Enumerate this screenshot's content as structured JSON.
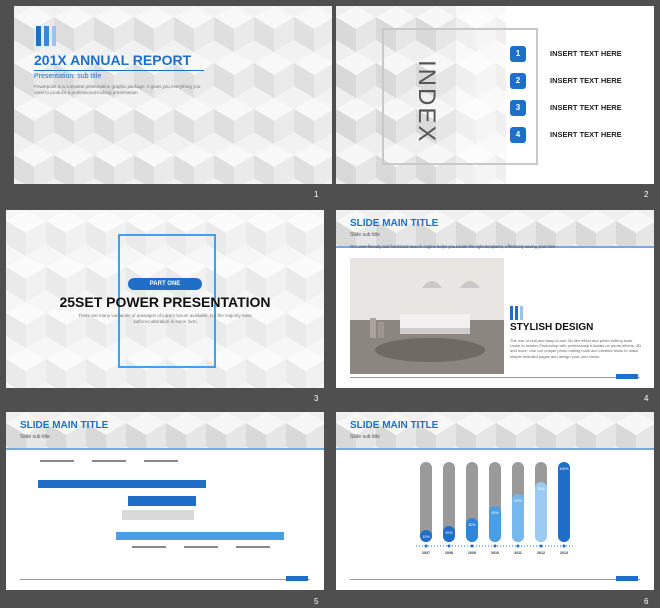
{
  "slides": [
    {
      "number": "1",
      "title": "201X ANNUAL REPORT",
      "subtitle": "Presentation: sub title",
      "body": "Powerpoint is a complete presentation graphic package. It gives you everything you need to produce a professional-looking presentation"
    },
    {
      "number": "2",
      "index_label": "INDEX",
      "items": [
        {
          "n": "1",
          "text": "INSERT TEXT HERE"
        },
        {
          "n": "2",
          "text": "INSERT TEXT HERE"
        },
        {
          "n": "3",
          "text": "INSERT TEXT HERE"
        },
        {
          "n": "4",
          "text": "INSERT TEXT HERE"
        }
      ]
    },
    {
      "number": "3",
      "part": "PART ONE",
      "title": "25SET POWER PRESENTATION",
      "body": "There are many variations of passages of Lorem Ipsum available, but the majority have suffered alteration in some form"
    },
    {
      "number": "4",
      "title": "SLIDE MAIN TITLE",
      "subtitle": "Slide sub title",
      "intro": "Our user-friendly and functional search engine helps you locate the right templates, effectively saving your time.",
      "heading": "STYLISH DESIGN",
      "body": "The use of real and easy-to-use 3D-like effect and photo editing tools. Learn to master Photoshop with professional tutorials on photo effects, 3D and more. Use our unique photo editing tools and creative tricks to make simple beautiful pages and design your own vision."
    },
    {
      "number": "5",
      "title": "SLIDE MAIN TITLE",
      "subtitle": "Slide sub title"
    },
    {
      "number": "6",
      "title": "SLIDE MAIN TITLE",
      "subtitle": "Slide sub title"
    }
  ],
  "chart_data": {
    "type": "bar",
    "categories": [
      "2007",
      "2008",
      "2009",
      "2010",
      "2011",
      "2012",
      "2013"
    ],
    "values": [
      10,
      20,
      30,
      45,
      60,
      75,
      100
    ],
    "value_labels": [
      "10%",
      "20%",
      "30%",
      "45%",
      "60%",
      "75%",
      "100%"
    ],
    "ylim": [
      0,
      100
    ],
    "colors": [
      "#1f6fc9",
      "#1f6fc9",
      "#2f86d8",
      "#4a9ee6",
      "#76b8ee",
      "#9bcbf3",
      "#1f6fc9"
    ],
    "track_color": "#9a9a9a"
  },
  "colors": {
    "accent": "#1f6fc9",
    "background": "#4f4f4f"
  }
}
